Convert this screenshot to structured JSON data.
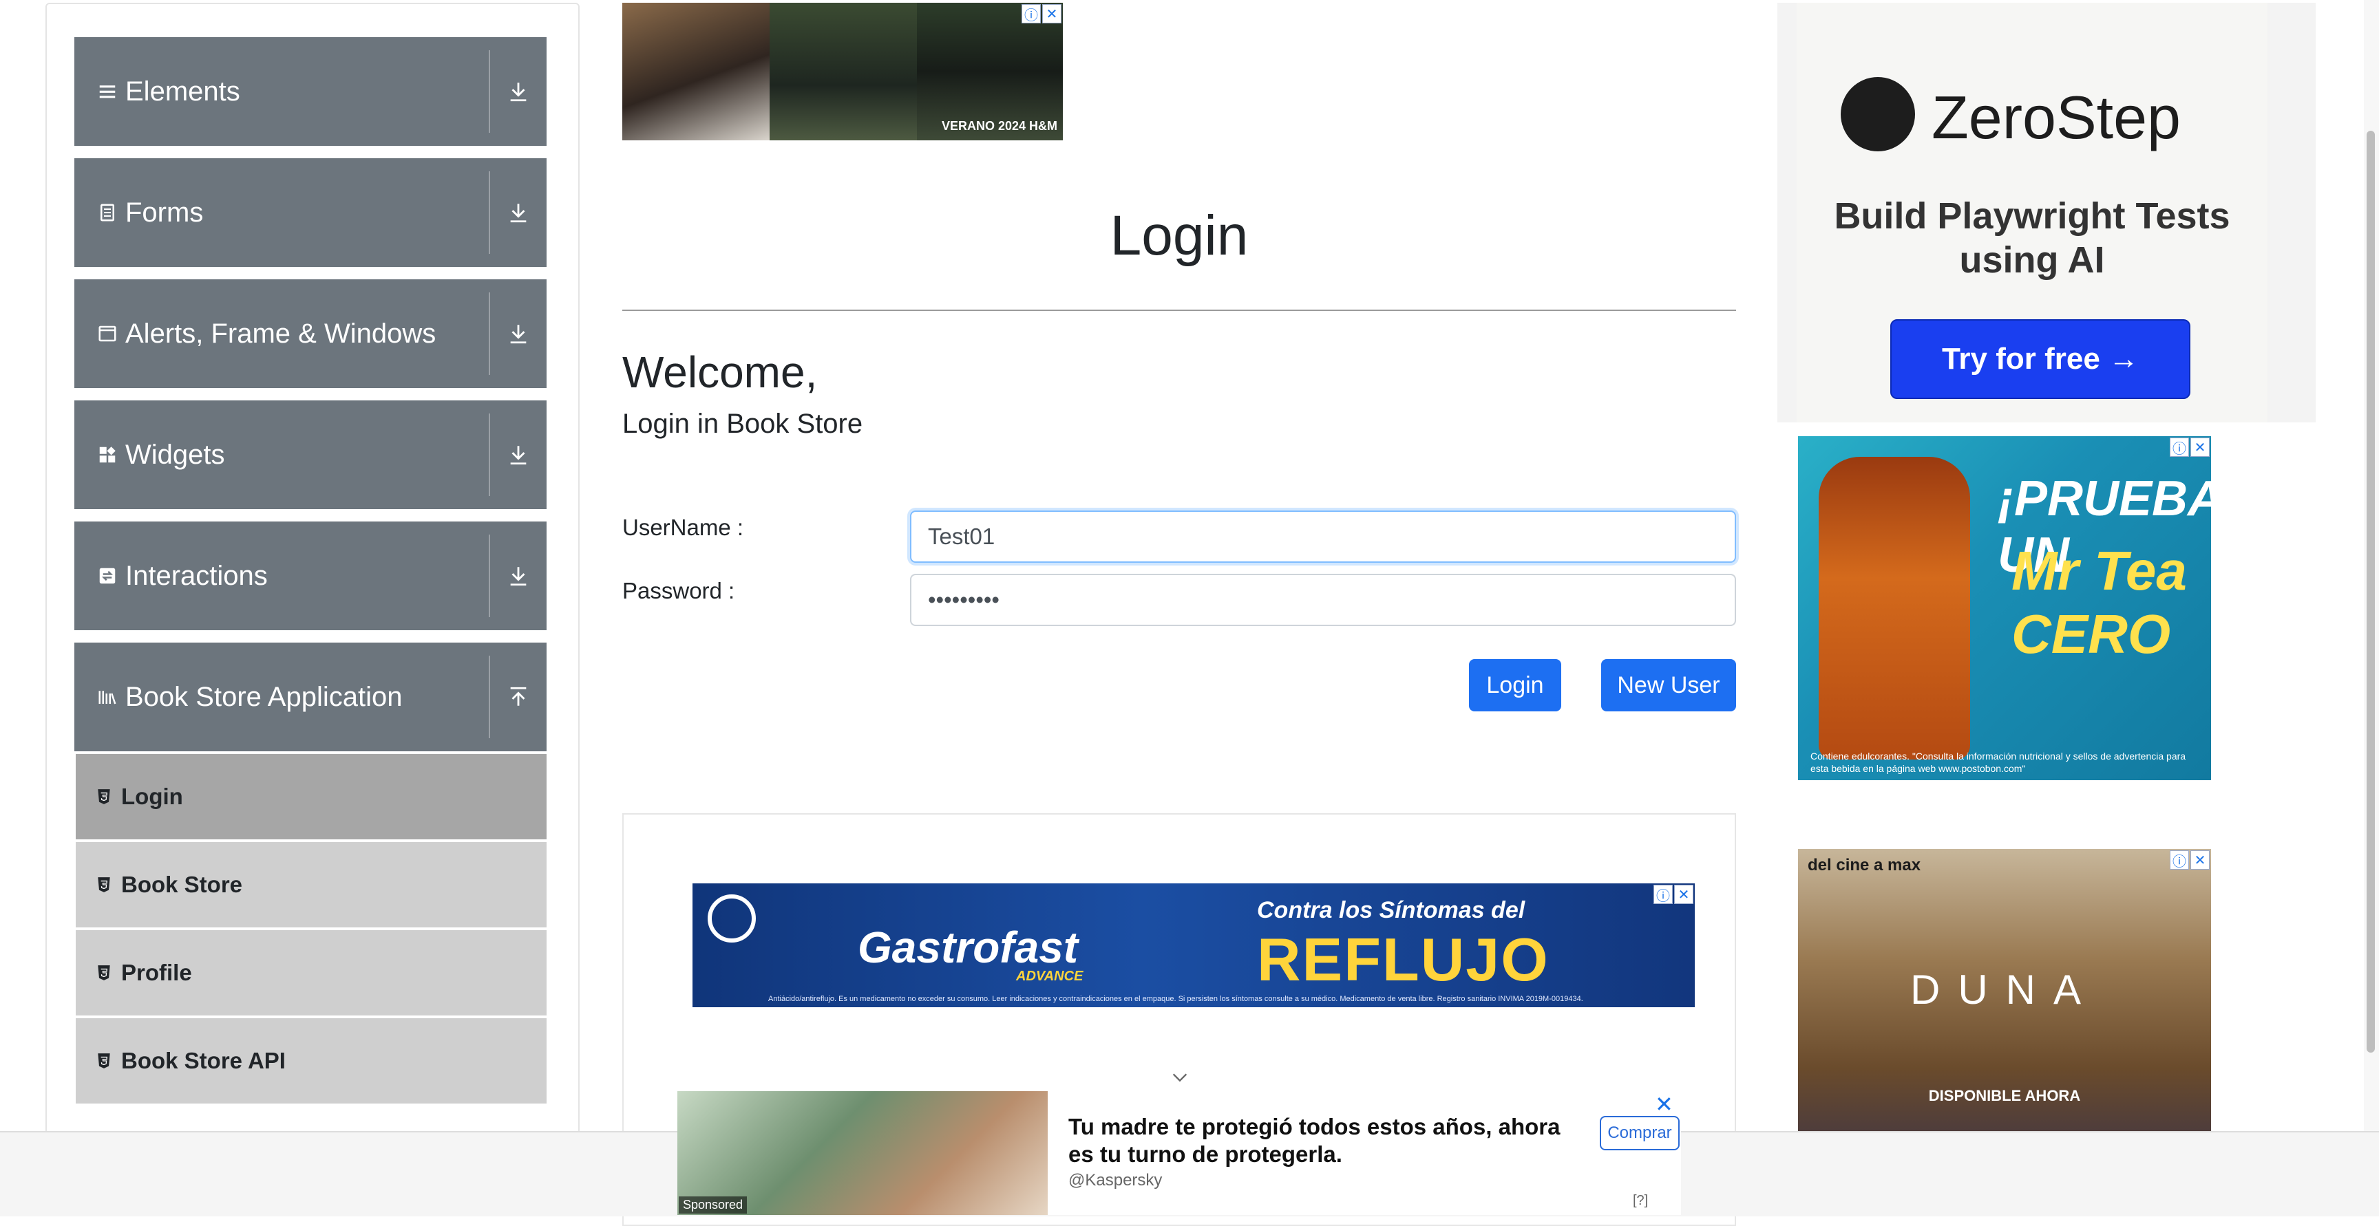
{
  "sidebar": {
    "groups": [
      {
        "label": "Elements",
        "icon": "hamburger-icon",
        "arrow": "download-arrow-icon"
      },
      {
        "label": "Forms",
        "icon": "document-icon",
        "arrow": "download-arrow-icon"
      },
      {
        "label": "Alerts, Frame & Windows",
        "icon": "window-icon",
        "arrow": "download-arrow-icon"
      },
      {
        "label": "Widgets",
        "icon": "widgets-icon",
        "arrow": "download-arrow-icon"
      },
      {
        "label": "Interactions",
        "icon": "interactions-icon",
        "arrow": "download-arrow-icon"
      },
      {
        "label": "Book Store Application",
        "icon": "books-icon",
        "arrow": "upload-arrow-icon"
      }
    ],
    "items": [
      {
        "label": "Login",
        "active": true
      },
      {
        "label": "Book Store",
        "active": false
      },
      {
        "label": "Profile",
        "active": false
      },
      {
        "label": "Book Store API",
        "active": false
      }
    ]
  },
  "ads": {
    "top_banner_brand": "VERANO 2024  H&M",
    "zerostep": {
      "brand": "ZeroStep",
      "tagline": "Build Playwright Tests using AI",
      "cta": "Try for free →"
    },
    "tea": {
      "headline1": "¡PRUEBA UN",
      "headline2": "Mr Tea CERO",
      "fine": "Contiene edulcorantes. \"Consulta la información nutricional y sellos de advertencia para esta bebida en la página web www.postobon.com\""
    },
    "dune": {
      "brand": "del cine a max",
      "title": "DUNA",
      "subtitle": "DISPONIBLE AHORA"
    },
    "gastro": {
      "brand": "Gastrofast",
      "brand2": "ADVANCE",
      "line1": "Contra los Síntomas del",
      "line2": "REFLUJO",
      "fine": "Antiácido/antireflujo. Es un medicamento no exceder su consumo. Leer indicaciones y contraindicaciones en el empaque. Si persisten los síntomas consulte a su médico. Medicamento de venta libre. Registro sanitario INVIMA 2019M-0019434."
    },
    "sticky": {
      "headline": "Tu madre te protegió todos estos años, ahora es tu turno de protegerla.",
      "handle": "@Kaspersky",
      "buy": "Comprar",
      "sponsored": "Sponsored",
      "help": "[?]"
    }
  },
  "main": {
    "title": "Login",
    "welcome": "Welcome,",
    "subtitle": "Login in Book Store",
    "username_label": "UserName :",
    "password_label": "Password :",
    "username_value": "Test01",
    "password_value": "•••••••••",
    "login_button": "Login",
    "new_user_button": "New User"
  },
  "colors": {
    "sidebar_group": "#6c757d",
    "sidebar_item": "#cfcfcf",
    "sidebar_item_active": "#a6a6a6",
    "primary_button": "#1d6ff2"
  }
}
